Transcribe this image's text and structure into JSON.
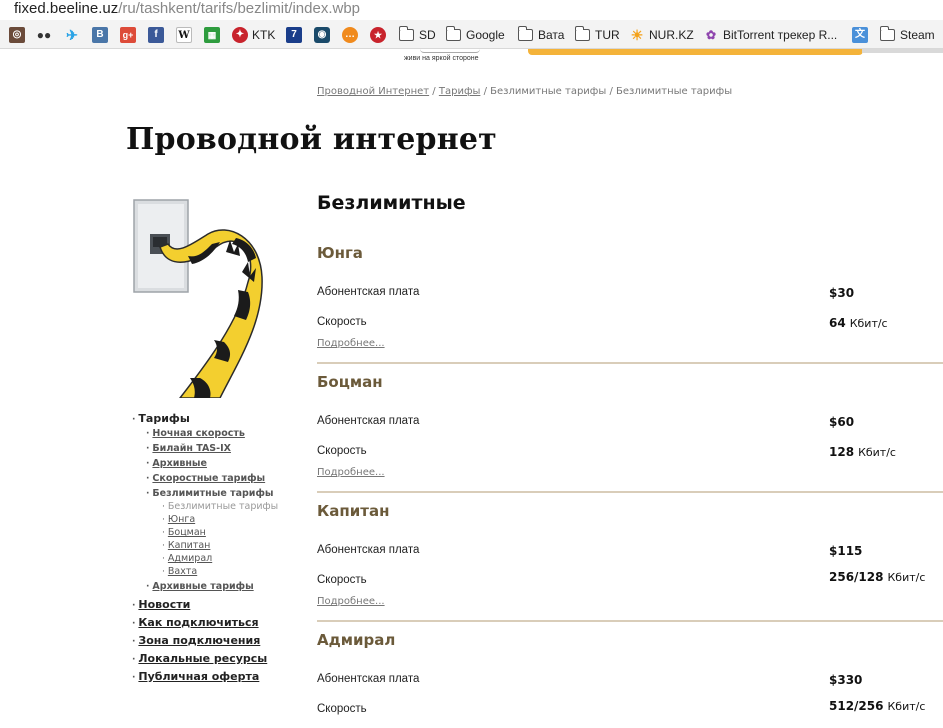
{
  "browser": {
    "url_host": "fixed.beeline.uz",
    "url_path": "/ru/tashkent/tarifs/bezlimit/index.wbp",
    "bookmarks": [
      {
        "icon": "instagram-icon",
        "label": ""
      },
      {
        "icon": "people-icon",
        "label": ""
      },
      {
        "icon": "twitter-icon",
        "label": ""
      },
      {
        "icon": "vk-icon",
        "label": ""
      },
      {
        "icon": "google-plus-icon",
        "label": ""
      },
      {
        "icon": "facebook-icon",
        "label": ""
      },
      {
        "icon": "wikipedia-icon",
        "label": ""
      },
      {
        "icon": "chart-icon",
        "label": ""
      },
      {
        "icon": "ktk-icon",
        "label": "KTK"
      },
      {
        "icon": "channel7-icon",
        "label": ""
      },
      {
        "icon": "camera-icon",
        "label": ""
      },
      {
        "icon": "chat-icon",
        "label": ""
      },
      {
        "icon": "star-icon",
        "label": ""
      },
      {
        "icon": "folder-icon",
        "label": "SD"
      },
      {
        "icon": "folder-icon",
        "label": "Google"
      },
      {
        "icon": "folder-icon",
        "label": "Вата"
      },
      {
        "icon": "folder-icon",
        "label": "TUR"
      },
      {
        "icon": "sun-icon",
        "label": "NUR.KZ"
      },
      {
        "icon": "torrent-icon",
        "label": "BitTorrent трекер R..."
      },
      {
        "icon": "translate-icon",
        "label": ""
      },
      {
        "icon": "folder-icon",
        "label": "Steam"
      }
    ]
  },
  "header": {
    "slogan": "живи на яркой стороне",
    "accent_color": "#f4b33a"
  },
  "breadcrumb": {
    "items": [
      "Проводной Интернет",
      "Тарифы",
      "Безлимитные тарифы",
      "Безлимитные тарифы"
    ],
    "separator": "/"
  },
  "page": {
    "title": "Проводной интернет",
    "section_title": "Безлимитные"
  },
  "leftnav": {
    "tariffs": "Тарифы",
    "night_speed": "Ночная скорость",
    "beeline_tasix": "Билайн TAS-IX",
    "archive": "Архивные",
    "speed_tariffs": "Скоростные тарифы",
    "unlimited_tariffs": "Безлимитные тарифы",
    "unlimited_current": "Безлимитные тарифы",
    "yunga": "Юнга",
    "botsman": "Боцман",
    "kapitan": "Капитан",
    "admiral": "Адмирал",
    "vakhta": "Вахта",
    "archive_tariffs": "Архивные тарифы",
    "news": "Новости",
    "how_connect": "Как подключиться",
    "zone": "Зона подключения",
    "local_resources": "Локальные ресурсы",
    "public_offer": "Публичная оферта"
  },
  "tariffs": [
    {
      "name": "Юнга",
      "fee_label": "Абонентская плата",
      "fee": "$30",
      "speed_label": "Скорость",
      "speed": "64",
      "unit": "Кбит/с",
      "more": "Подробнее..."
    },
    {
      "name": "Боцман",
      "fee_label": "Абонентская плата",
      "fee": "$60",
      "speed_label": "Скорость",
      "speed": "128",
      "unit": "Кбит/с",
      "more": "Подробнее..."
    },
    {
      "name": "Капитан",
      "fee_label": "Абонентская плата",
      "fee": "$115",
      "speed_label": "Скорость",
      "speed": "256/128",
      "unit": "Кбит/с",
      "more": "Подробнее..."
    },
    {
      "name": "Адмирал",
      "fee_label": "Абонентская плата",
      "fee": "$330",
      "speed_label": "Скорость",
      "speed": "512/256",
      "unit": "Кбит/с",
      "more": ""
    }
  ]
}
